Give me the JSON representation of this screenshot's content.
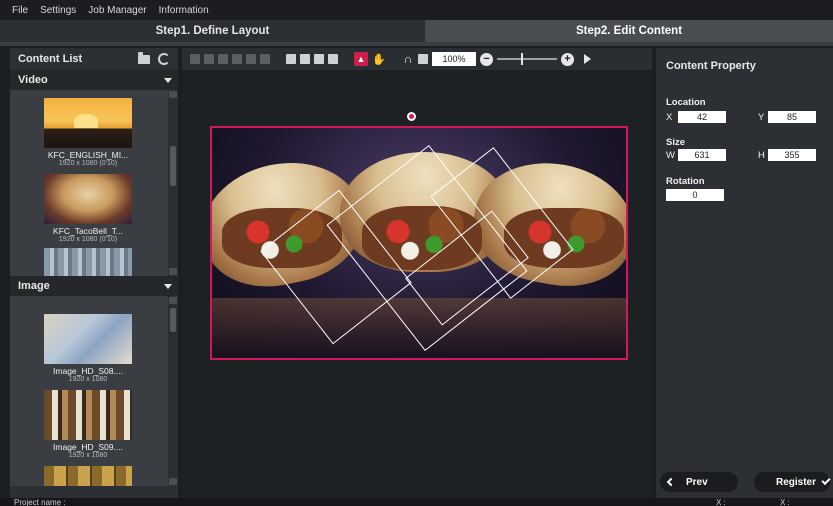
{
  "menu": [
    "File",
    "Settings",
    "Job Manager",
    "Information"
  ],
  "steps": {
    "step1": "Step1. Define Layout",
    "step2": "Step2. Edit Content"
  },
  "left": {
    "title": "Content List",
    "video_section": "Video",
    "image_section": "Image",
    "videos": [
      {
        "name": "KFC_ENGLISH_MI...",
        "meta": "1920 x 1080 (0'10)"
      },
      {
        "name": "KFC_TacoBell_T...",
        "meta": "1920 x 1080 (0'10)"
      }
    ],
    "images": [
      {
        "name": "Image_HD_S08....",
        "meta": "1920 x 1080"
      },
      {
        "name": "Image_HD_S09....",
        "meta": "1920 x 1080"
      }
    ]
  },
  "toolbar": {
    "zoom": "100%"
  },
  "property": {
    "title": "Content Property",
    "location_label": "Location",
    "x_label": "X",
    "y_label": "Y",
    "x": "42",
    "y": "85",
    "size_label": "Size",
    "w_label": "W",
    "h_label": "H",
    "w": "631",
    "h": "355",
    "rotation_label": "Rotation",
    "rotation": "0",
    "prev": "Prev",
    "register": "Register"
  },
  "status": {
    "project": "Project name :",
    "x1": "X :",
    "x2": "X :"
  }
}
